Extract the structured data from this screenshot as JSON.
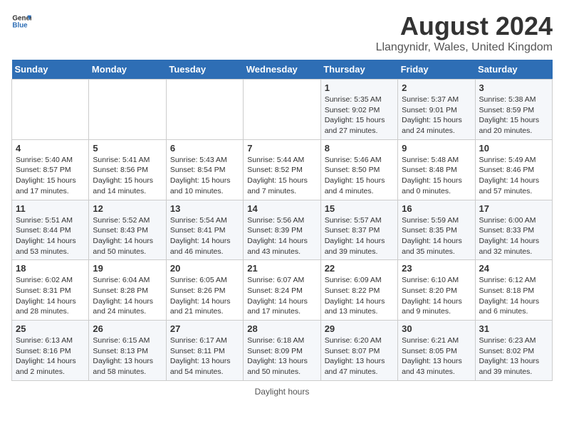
{
  "header": {
    "logo_general": "General",
    "logo_blue": "Blue",
    "main_title": "August 2024",
    "subtitle": "Llangynidr, Wales, United Kingdom"
  },
  "weekdays": [
    "Sunday",
    "Monday",
    "Tuesday",
    "Wednesday",
    "Thursday",
    "Friday",
    "Saturday"
  ],
  "weeks": [
    [
      {
        "day": "",
        "info": ""
      },
      {
        "day": "",
        "info": ""
      },
      {
        "day": "",
        "info": ""
      },
      {
        "day": "",
        "info": ""
      },
      {
        "day": "1",
        "info": "Sunrise: 5:35 AM\nSunset: 9:02 PM\nDaylight: 15 hours and 27 minutes."
      },
      {
        "day": "2",
        "info": "Sunrise: 5:37 AM\nSunset: 9:01 PM\nDaylight: 15 hours and 24 minutes."
      },
      {
        "day": "3",
        "info": "Sunrise: 5:38 AM\nSunset: 8:59 PM\nDaylight: 15 hours and 20 minutes."
      }
    ],
    [
      {
        "day": "4",
        "info": "Sunrise: 5:40 AM\nSunset: 8:57 PM\nDaylight: 15 hours and 17 minutes."
      },
      {
        "day": "5",
        "info": "Sunrise: 5:41 AM\nSunset: 8:56 PM\nDaylight: 15 hours and 14 minutes."
      },
      {
        "day": "6",
        "info": "Sunrise: 5:43 AM\nSunset: 8:54 PM\nDaylight: 15 hours and 10 minutes."
      },
      {
        "day": "7",
        "info": "Sunrise: 5:44 AM\nSunset: 8:52 PM\nDaylight: 15 hours and 7 minutes."
      },
      {
        "day": "8",
        "info": "Sunrise: 5:46 AM\nSunset: 8:50 PM\nDaylight: 15 hours and 4 minutes."
      },
      {
        "day": "9",
        "info": "Sunrise: 5:48 AM\nSunset: 8:48 PM\nDaylight: 15 hours and 0 minutes."
      },
      {
        "day": "10",
        "info": "Sunrise: 5:49 AM\nSunset: 8:46 PM\nDaylight: 14 hours and 57 minutes."
      }
    ],
    [
      {
        "day": "11",
        "info": "Sunrise: 5:51 AM\nSunset: 8:44 PM\nDaylight: 14 hours and 53 minutes."
      },
      {
        "day": "12",
        "info": "Sunrise: 5:52 AM\nSunset: 8:43 PM\nDaylight: 14 hours and 50 minutes."
      },
      {
        "day": "13",
        "info": "Sunrise: 5:54 AM\nSunset: 8:41 PM\nDaylight: 14 hours and 46 minutes."
      },
      {
        "day": "14",
        "info": "Sunrise: 5:56 AM\nSunset: 8:39 PM\nDaylight: 14 hours and 43 minutes."
      },
      {
        "day": "15",
        "info": "Sunrise: 5:57 AM\nSunset: 8:37 PM\nDaylight: 14 hours and 39 minutes."
      },
      {
        "day": "16",
        "info": "Sunrise: 5:59 AM\nSunset: 8:35 PM\nDaylight: 14 hours and 35 minutes."
      },
      {
        "day": "17",
        "info": "Sunrise: 6:00 AM\nSunset: 8:33 PM\nDaylight: 14 hours and 32 minutes."
      }
    ],
    [
      {
        "day": "18",
        "info": "Sunrise: 6:02 AM\nSunset: 8:31 PM\nDaylight: 14 hours and 28 minutes."
      },
      {
        "day": "19",
        "info": "Sunrise: 6:04 AM\nSunset: 8:28 PM\nDaylight: 14 hours and 24 minutes."
      },
      {
        "day": "20",
        "info": "Sunrise: 6:05 AM\nSunset: 8:26 PM\nDaylight: 14 hours and 21 minutes."
      },
      {
        "day": "21",
        "info": "Sunrise: 6:07 AM\nSunset: 8:24 PM\nDaylight: 14 hours and 17 minutes."
      },
      {
        "day": "22",
        "info": "Sunrise: 6:09 AM\nSunset: 8:22 PM\nDaylight: 14 hours and 13 minutes."
      },
      {
        "day": "23",
        "info": "Sunrise: 6:10 AM\nSunset: 8:20 PM\nDaylight: 14 hours and 9 minutes."
      },
      {
        "day": "24",
        "info": "Sunrise: 6:12 AM\nSunset: 8:18 PM\nDaylight: 14 hours and 6 minutes."
      }
    ],
    [
      {
        "day": "25",
        "info": "Sunrise: 6:13 AM\nSunset: 8:16 PM\nDaylight: 14 hours and 2 minutes."
      },
      {
        "day": "26",
        "info": "Sunrise: 6:15 AM\nSunset: 8:13 PM\nDaylight: 13 hours and 58 minutes."
      },
      {
        "day": "27",
        "info": "Sunrise: 6:17 AM\nSunset: 8:11 PM\nDaylight: 13 hours and 54 minutes."
      },
      {
        "day": "28",
        "info": "Sunrise: 6:18 AM\nSunset: 8:09 PM\nDaylight: 13 hours and 50 minutes."
      },
      {
        "day": "29",
        "info": "Sunrise: 6:20 AM\nSunset: 8:07 PM\nDaylight: 13 hours and 47 minutes."
      },
      {
        "day": "30",
        "info": "Sunrise: 6:21 AM\nSunset: 8:05 PM\nDaylight: 13 hours and 43 minutes."
      },
      {
        "day": "31",
        "info": "Sunrise: 6:23 AM\nSunset: 8:02 PM\nDaylight: 13 hours and 39 minutes."
      }
    ]
  ],
  "footer": {
    "note": "Daylight hours"
  }
}
